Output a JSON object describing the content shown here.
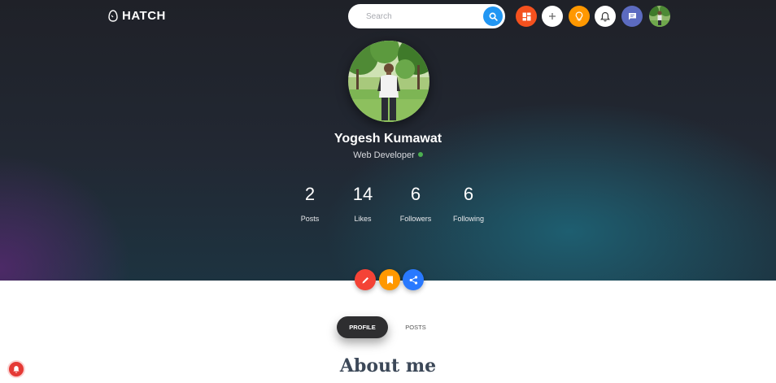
{
  "header": {
    "logo_text": "HATCH",
    "search_placeholder": "Search",
    "nav_icons": [
      "dashboard-icon",
      "plus-icon",
      "lightbulb-icon",
      "bell-icon",
      "chat-icon"
    ]
  },
  "profile": {
    "name": "Yogesh Kumawat",
    "role": "Web Developer",
    "online": true,
    "stats": [
      {
        "value": "2",
        "label": "Posts"
      },
      {
        "value": "14",
        "label": "Likes"
      },
      {
        "value": "6",
        "label": "Followers"
      },
      {
        "value": "6",
        "label": "Following"
      }
    ]
  },
  "actions": [
    "edit-icon",
    "bookmark-icon",
    "share-icon"
  ],
  "tabs": {
    "profile_label": "PROFILE",
    "posts_label": "POSTS"
  },
  "about_title": "About me",
  "colors": {
    "search_accent": "#2196f3",
    "dashboard": "#f4511e",
    "lightbulb": "#ff9800",
    "chat": "#5c6bc0",
    "edit": "#f44336",
    "bookmark": "#ff9800",
    "share": "#2979ff",
    "online": "#4caf50",
    "notify": "#e53935"
  }
}
